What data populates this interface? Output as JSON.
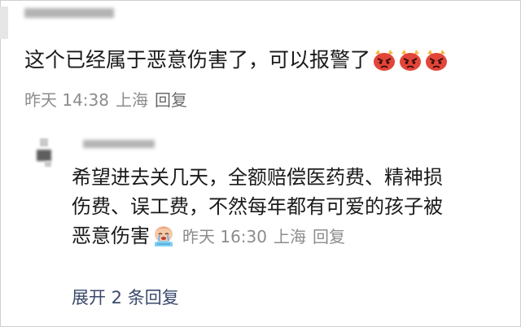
{
  "comment": {
    "text": "这个已经属于恶意伤害了，可以报警了",
    "emojis": [
      "angry-face-icon",
      "angry-face-icon",
      "angry-face-icon"
    ],
    "time": "昨天 14:38",
    "location": "上海",
    "reply_label": "回复"
  },
  "reply": {
    "lines": [
      "希望进去关几天，全额赔偿医药费、精神损",
      "伤费、误工费，不然每年都有可爱的孩子被",
      "恶意伤害"
    ],
    "emoji": "crying-child-icon",
    "time": "昨天 16:30",
    "location": "上海",
    "reply_label": "回复"
  },
  "expand_label": "展开 2 条回复",
  "colors": {
    "meta": "#8c8c8c",
    "expand": "#3a4a6b",
    "emoji_red": "#e2453a"
  }
}
